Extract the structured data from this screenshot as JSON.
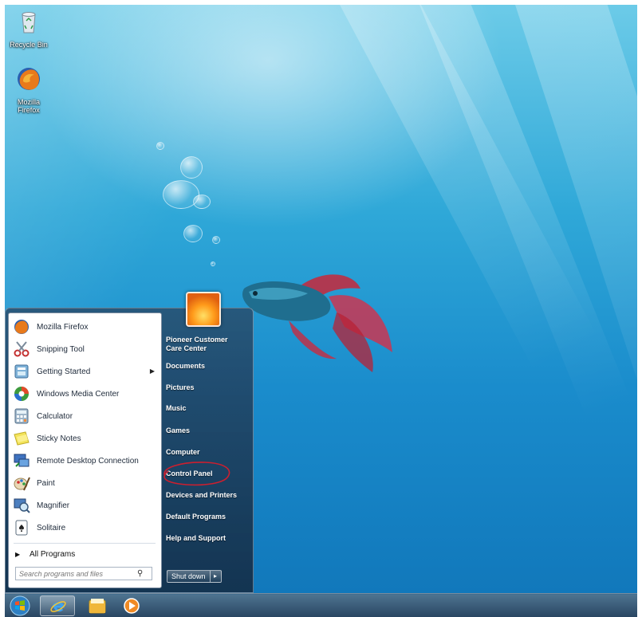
{
  "desktop": {
    "icons": [
      {
        "label": "Recycle Bin",
        "icon": "recycle-bin-icon"
      },
      {
        "label": "Mozilla Firefox",
        "icon": "firefox-icon"
      }
    ]
  },
  "start_menu": {
    "programs": [
      {
        "label": "Mozilla Firefox",
        "icon": "firefox-icon",
        "has_submenu": false
      },
      {
        "label": "Snipping Tool",
        "icon": "scissors-icon",
        "has_submenu": false
      },
      {
        "label": "Getting Started",
        "icon": "getting-started-icon",
        "has_submenu": true
      },
      {
        "label": "Windows Media Center",
        "icon": "media-center-icon",
        "has_submenu": false
      },
      {
        "label": "Calculator",
        "icon": "calculator-icon",
        "has_submenu": false
      },
      {
        "label": "Sticky Notes",
        "icon": "sticky-notes-icon",
        "has_submenu": false
      },
      {
        "label": "Remote Desktop Connection",
        "icon": "remote-desktop-icon",
        "has_submenu": false
      },
      {
        "label": "Paint",
        "icon": "paint-icon",
        "has_submenu": false
      },
      {
        "label": "Magnifier",
        "icon": "magnifier-icon",
        "has_submenu": false
      },
      {
        "label": "Solitaire",
        "icon": "solitaire-icon",
        "has_submenu": false
      }
    ],
    "all_programs": "All Programs",
    "search_placeholder": "Search programs and files",
    "right_links": [
      {
        "label": "Pioneer Customer Care Center"
      },
      {
        "label": "Documents"
      },
      {
        "label": "Pictures"
      },
      {
        "label": "Music"
      },
      {
        "label": "Games"
      },
      {
        "label": "Computer"
      },
      {
        "label": "Control Panel",
        "highlighted": true
      },
      {
        "label": "Devices and Printers"
      },
      {
        "label": "Default Programs"
      },
      {
        "label": "Help and Support"
      }
    ],
    "shutdown_label": "Shut down",
    "annotation_color": "#cc1f2f"
  },
  "taskbar": {
    "items": [
      {
        "name": "start-orb-icon"
      },
      {
        "name": "internet-explorer-icon"
      },
      {
        "name": "windows-explorer-icon"
      },
      {
        "name": "media-player-icon"
      }
    ]
  }
}
